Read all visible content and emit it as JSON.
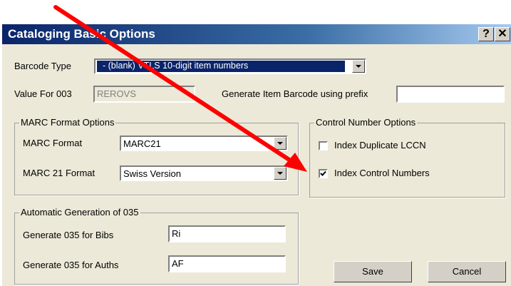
{
  "dialog": {
    "title": "Cataloging Basic Options",
    "help_label": "?",
    "close_label": "✕"
  },
  "barcode": {
    "label": "Barcode Type",
    "value": " - (blank) VTLS 10-digit item numbers"
  },
  "value003": {
    "label": "Value For 003",
    "value": "REROVS"
  },
  "prefix": {
    "label": "Generate Item Barcode using prefix",
    "value": ""
  },
  "marc_options": {
    "legend": "MARC Format Options",
    "format_label": "MARC Format",
    "format_value": "MARC21",
    "marc21_label": "MARC 21 Format",
    "marc21_value": "Swiss Version"
  },
  "control_options": {
    "legend": "Control Number Options",
    "dup_lccn_label": "Index Duplicate LCCN",
    "dup_lccn_checked": false,
    "index_cn_label": "Index Control Numbers",
    "index_cn_checked": true
  },
  "auto035": {
    "legend": "Automatic Generation of 035",
    "bibs_label": "Generate 035 for Bibs",
    "bibs_value": "Ri",
    "auths_label": "Generate 035 for Auths",
    "auths_value": "AF"
  },
  "buttons": {
    "save": "Save",
    "cancel": "Cancel"
  },
  "colors": {
    "annotation_arrow": "#ff0000",
    "title_bar": "#0a246a",
    "selection": "#0a246a"
  }
}
